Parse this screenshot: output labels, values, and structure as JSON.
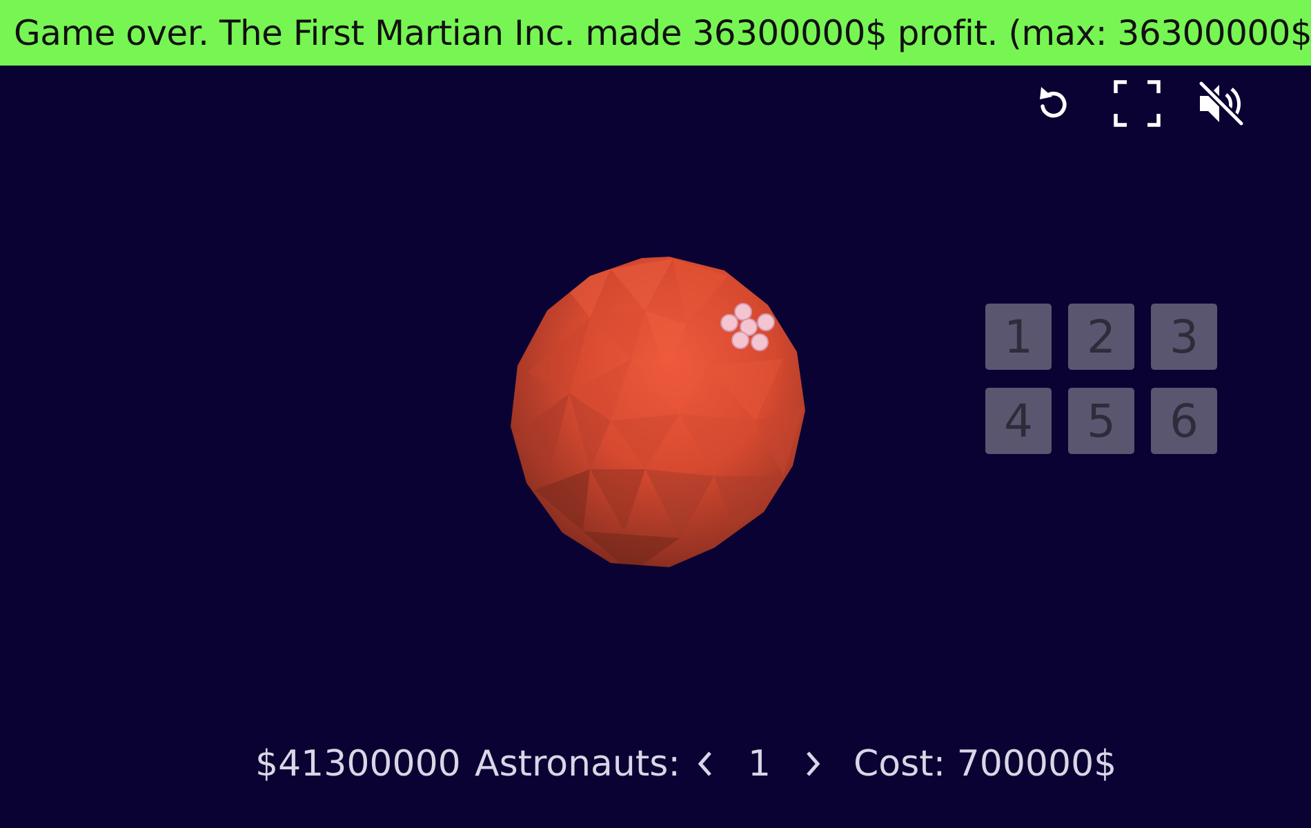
{
  "banner": {
    "message": "Game over. The First Martian Inc. made 36300000$ profit. (max: 36300000$)",
    "color": "#77f553"
  },
  "controls": {
    "icons": [
      "restart-icon",
      "fullscreen-icon",
      "mute-icon"
    ]
  },
  "levels": {
    "buttons": [
      "1",
      "2",
      "3",
      "4",
      "5",
      "6"
    ]
  },
  "hud": {
    "money": "$41300000",
    "astronauts_label": "Astronauts:",
    "astronauts_count": "1",
    "cost": "Cost: 700000$"
  },
  "colors": {
    "background": "#0a0233",
    "planet": "#e8553a",
    "colony": "#f4c4d0",
    "level_button": "#5b5670"
  }
}
